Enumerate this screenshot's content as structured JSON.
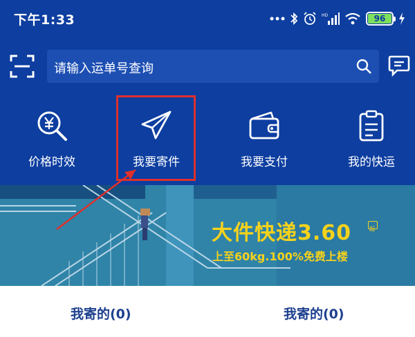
{
  "status_bar": {
    "time": "下午1:33",
    "signal_label": "HD",
    "battery": "96"
  },
  "search": {
    "placeholder": "请输入运单号查询"
  },
  "actions": [
    {
      "label": "价格时效",
      "icon": "price-search-icon"
    },
    {
      "label": "我要寄件",
      "icon": "paper-plane-icon"
    },
    {
      "label": "我要支付",
      "icon": "wallet-icon"
    },
    {
      "label": "我的快运",
      "icon": "clipboard-icon"
    }
  ],
  "banner": {
    "headline": "大件快递3.60",
    "badge": "起",
    "subline": "上至60kg.100%免费上楼"
  },
  "tabs": {
    "sent": "我寄的(0)",
    "received": "我寄的(0)"
  },
  "colors": {
    "header_bg": "#0d3ea0",
    "search_bg": "#1d4fb3",
    "highlight": "#e0302b",
    "banner_text": "#f6d21c",
    "tab_text": "#1c3f8e"
  }
}
